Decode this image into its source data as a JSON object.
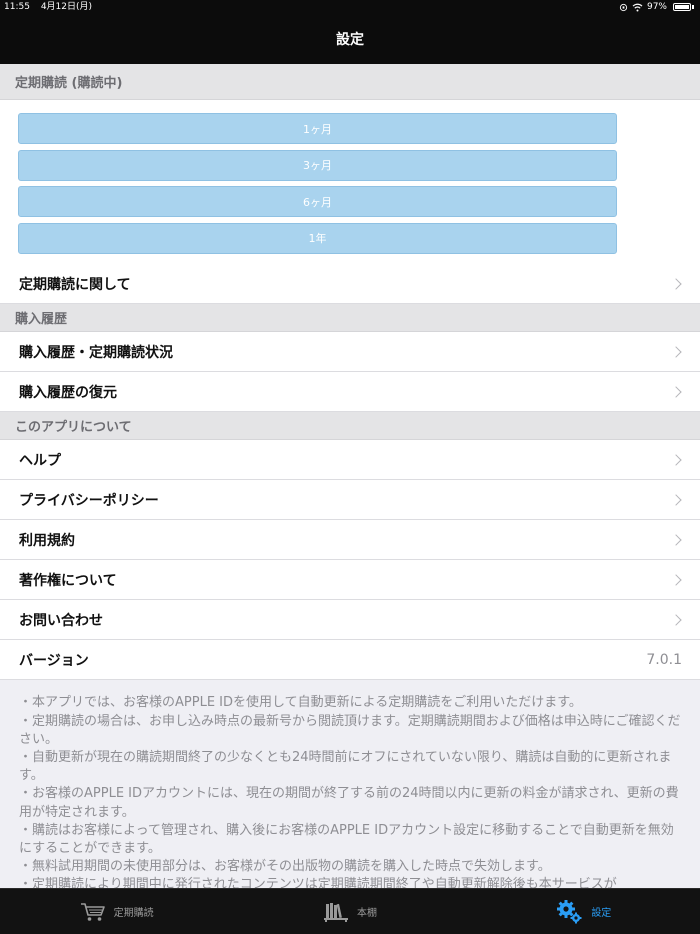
{
  "status_bar": {
    "time": "11:55",
    "date": "4月12日(月)",
    "battery": "97%",
    "icons": [
      "orientation-lock-icon",
      "wifi-icon",
      "battery-icon"
    ]
  },
  "nav": {
    "title": "設定"
  },
  "subscription": {
    "header": "定期購読 (購読中)",
    "plans": [
      "1ヶ月",
      "3ヶ月",
      "6ヶ月",
      "1年"
    ],
    "about_label": "定期購読に関して"
  },
  "history": {
    "header": "購入履歴",
    "items": [
      "購入履歴・定期購読状況",
      "購入履歴の復元"
    ]
  },
  "about_app": {
    "header": "このアプリについて",
    "items": [
      "ヘルプ",
      "プライバシーポリシー",
      "利用規約",
      "著作権について",
      "お問い合わせ"
    ],
    "version_label": "バージョン",
    "version_value": "7.0.1"
  },
  "notes": [
    "・本アプリでは、お客様のAPPLE IDを使用して自動更新による定期購読をご利用いただけます。",
    "・定期購読の場合は、お申し込み時点の最新号から閲読頂けます。定期購読期間および価格は申込時にご確認ください。",
    "・自動更新が現在の購読期間終了の少なくとも24時間前にオフにされていない限り、購読は自動的に更新されます。",
    "・お客様のAPPLE IDアカウントには、現在の期間が終了する前の24時間以内に更新の料金が請求され、更新の費用が特定されます。",
    "・購読はお客様によって管理され、購入後にお客様のAPPLE IDアカウント設定に移動することで自動更新を無効にすることができます。",
    "・無料試用期間の未使用部分は、お客様がその出版物の購読を購入した時点で失効します。",
    "・定期購読により期間中に発行されたコンテンツは定期購読期間終了や自動更新解除後も本サービスが"
  ],
  "tabs": [
    {
      "label": "定期購読",
      "icon": "cart-icon"
    },
    {
      "label": "本棚",
      "icon": "bookshelf-icon"
    },
    {
      "label": "設定",
      "icon": "gear-icon"
    }
  ],
  "colors": {
    "accent": "#2a9df4",
    "plan_button": "#a9d3ee",
    "bar": "#0c0c0c"
  }
}
